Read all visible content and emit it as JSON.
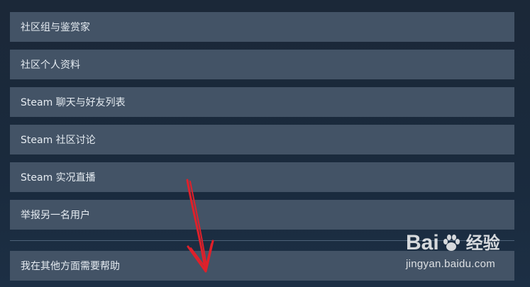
{
  "help_options": [
    {
      "label": "社区组与鉴赏家"
    },
    {
      "label": "社区个人资料"
    },
    {
      "label": "Steam 聊天与好友列表"
    },
    {
      "label": "Steam 社区讨论"
    },
    {
      "label": "Steam 实况直播"
    },
    {
      "label": "举报另一名用户"
    }
  ],
  "other_help": {
    "label": "我在其他方面需要帮助"
  },
  "watermark": {
    "logo_prefix": "Bai",
    "logo_suffix": "经验",
    "url": "jingyan.baidu.com"
  },
  "colors": {
    "background": "#1b2838",
    "item_background": "#435366",
    "item_text": "#e6ecf2",
    "annotation_arrow": "#e0202a"
  }
}
